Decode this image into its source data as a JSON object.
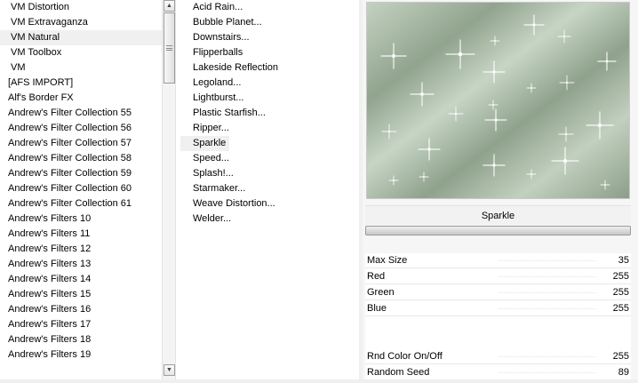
{
  "categories": {
    "items": [
      {
        "label": "VM Distortion",
        "indent": true
      },
      {
        "label": "VM Extravaganza",
        "indent": true
      },
      {
        "label": "VM Natural",
        "indent": true,
        "selected": true
      },
      {
        "label": "VM Toolbox",
        "indent": true
      },
      {
        "label": "VM",
        "indent": true
      },
      {
        "label": "[AFS IMPORT]"
      },
      {
        "label": "Alf's Border FX"
      },
      {
        "label": "Andrew's Filter Collection 55"
      },
      {
        "label": "Andrew's Filter Collection 56"
      },
      {
        "label": "Andrew's Filter Collection 57"
      },
      {
        "label": "Andrew's Filter Collection 58"
      },
      {
        "label": "Andrew's Filter Collection 59"
      },
      {
        "label": "Andrew's Filter Collection 60"
      },
      {
        "label": "Andrew's Filter Collection 61"
      },
      {
        "label": "Andrew's Filters 10"
      },
      {
        "label": "Andrew's Filters 11"
      },
      {
        "label": "Andrew's Filters 12"
      },
      {
        "label": "Andrew's Filters 13"
      },
      {
        "label": "Andrew's Filters 14"
      },
      {
        "label": "Andrew's Filters 15"
      },
      {
        "label": "Andrew's Filters 16"
      },
      {
        "label": "Andrew's Filters 17"
      },
      {
        "label": "Andrew's Filters 18"
      },
      {
        "label": "Andrew's Filters 19"
      }
    ]
  },
  "scrollbar": {
    "up_icon": "▲",
    "down_icon": "▼"
  },
  "filters": {
    "items": [
      {
        "label": "Acid Rain..."
      },
      {
        "label": "Bubble Planet..."
      },
      {
        "label": "Downstairs..."
      },
      {
        "label": "Flipperballs"
      },
      {
        "label": "Lakeside Reflection"
      },
      {
        "label": "Legoland..."
      },
      {
        "label": "Lightburst..."
      },
      {
        "label": "Plastic Starfish..."
      },
      {
        "label": "Ripper..."
      },
      {
        "label": "Sparkle",
        "selected": true
      },
      {
        "label": "Speed..."
      },
      {
        "label": "Splash!..."
      },
      {
        "label": "Starmaker..."
      },
      {
        "label": "Weave Distortion..."
      },
      {
        "label": "Welder..."
      }
    ]
  },
  "panel": {
    "title": "Sparkle",
    "params": [
      {
        "label": "Max Size",
        "value": "35"
      },
      {
        "label": "Red",
        "value": "255"
      },
      {
        "label": "Green",
        "value": "255"
      },
      {
        "label": "Blue",
        "value": "255"
      },
      {
        "label": "Rnd Color On/Off",
        "value": "255"
      },
      {
        "label": "Random Seed",
        "value": "89"
      }
    ]
  },
  "colors": {
    "preview_base": "#a7b9a3",
    "preview_light": "#c9d6c6",
    "preview_dark": "#879a84"
  }
}
